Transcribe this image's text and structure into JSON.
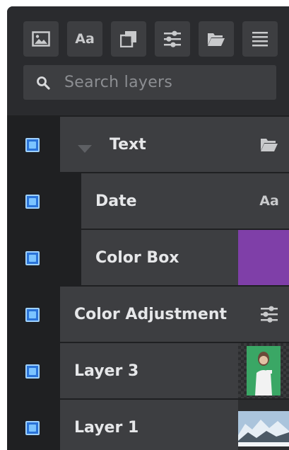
{
  "search": {
    "placeholder": "Search layers"
  },
  "toolbar": {
    "buttons": [
      {
        "icon": "image-icon"
      },
      {
        "icon": "text-icon",
        "label": "Aa"
      },
      {
        "icon": "duplicate-icon"
      },
      {
        "icon": "sliders-icon"
      },
      {
        "icon": "folder-icon"
      },
      {
        "icon": "menu-icon"
      }
    ]
  },
  "layers": [
    {
      "label": "Text",
      "type": "group",
      "icon": "folder-icon",
      "expanded": true
    },
    {
      "label": "Date",
      "type": "text",
      "badge": "Aa"
    },
    {
      "label": "Color Box",
      "type": "color",
      "swatch": "#7f3fa8"
    },
    {
      "label": "Color Adjustment",
      "type": "adjustment",
      "icon": "sliders-icon"
    },
    {
      "label": "Layer 3",
      "type": "image",
      "thumb": "green-screen-thumbnail"
    },
    {
      "label": "Layer 1",
      "type": "image",
      "thumb": "mountain-thumbnail"
    }
  ],
  "colors": {
    "panel": "#1f2022",
    "row": "#3d3e41",
    "checkbox": "#2a73d9",
    "accent": "#7f3fa8"
  }
}
